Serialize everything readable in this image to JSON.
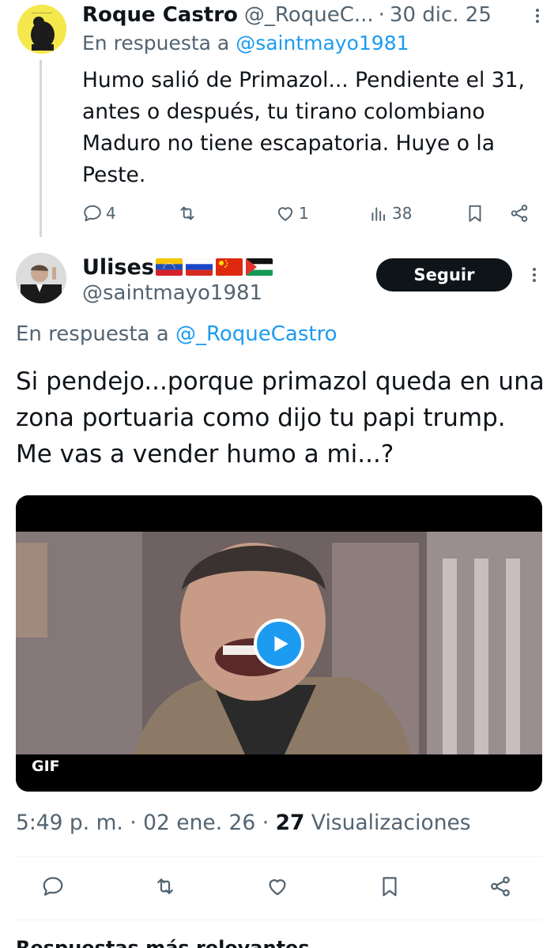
{
  "parent_tweet": {
    "name": "Roque Castro",
    "handle": "@_RoqueC...",
    "separator": "·",
    "date": "30 dic. 25",
    "reply_prefix": "En respuesta a",
    "reply_mention": "@saintmayo1981",
    "text": "Humo salió de Primazol... Pendiente el 31, antes o después, tu tirano colombiano Maduro no tiene escapatoria. Huye o la Peste.",
    "stats": {
      "replies": "4",
      "likes": "1",
      "views": "38"
    }
  },
  "main_tweet": {
    "name": "Ulises",
    "handle": "@saintmayo1981",
    "follow_label": "Seguir",
    "reply_prefix": "En respuesta a",
    "reply_mention": "@_RoqueCastro",
    "text": "Si pendejo...porque primazol queda en una zona portuaria como dijo tu papi trump. Me vas a vender humo a mi...?",
    "media": {
      "badge": "GIF"
    },
    "time": "5:49 p. m.",
    "separator": "·",
    "date": "02 ene. 26",
    "views_count": "27",
    "views_label": "Visualizaciones"
  },
  "replies_sort_label": "Respuestas más relevantes",
  "icons": {
    "reply": "comment-icon",
    "retweet": "retweet-icon",
    "like": "heart-icon",
    "views": "bar-chart-icon",
    "bookmark": "bookmark-icon",
    "share": "share-icon",
    "more": "more-icon",
    "play": "play-icon"
  },
  "colors": {
    "accent": "#1d9bf0",
    "text_primary": "#0f1419",
    "text_secondary": "#536471",
    "follow_bg": "#0f1419"
  }
}
